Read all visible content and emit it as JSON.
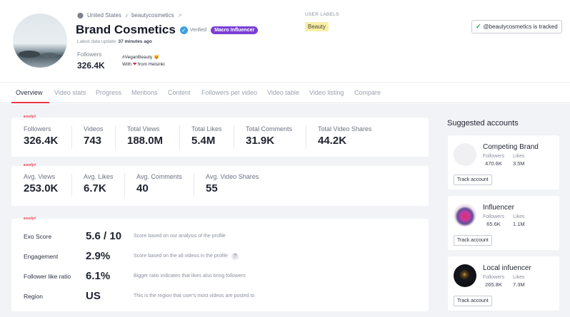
{
  "profile": {
    "location": "United States",
    "handle": "beautycosmetics",
    "name": "Brand Cosmetics",
    "verified_label": "Verified",
    "tier_badge": "Macro Influencer",
    "updated_prefix": "Latest data update:",
    "updated_value": "37 minutes ago",
    "followers_label": "Followers",
    "followers_value": "326.4K",
    "bio_line1": "#VeganBeauty 😺",
    "bio_line2_pre": "With",
    "bio_line2_post": "from Helsinki"
  },
  "labels": {
    "title": "USER LABELS",
    "items": [
      "Beauty"
    ]
  },
  "tracking": {
    "text": "@beautycosmetics is tracked"
  },
  "tabs": [
    {
      "label": "Overview",
      "active": true
    },
    {
      "label": "Video stats"
    },
    {
      "label": "Progress"
    },
    {
      "label": "Mentions"
    },
    {
      "label": "Content"
    },
    {
      "label": "Followers per video"
    },
    {
      "label": "Video table"
    },
    {
      "label": "Video listing"
    },
    {
      "label": "Compare"
    }
  ],
  "watermark": "exolyt",
  "summary": [
    {
      "label": "Followers",
      "value": "326.4K"
    },
    {
      "label": "Videos",
      "value": "743"
    },
    {
      "label": "Total Views",
      "value": "188.0M"
    },
    {
      "label": "Total Likes",
      "value": "5.4M"
    },
    {
      "label": "Total Comments",
      "value": "31.9K"
    },
    {
      "label": "Total Video Shares",
      "value": "44.2K"
    }
  ],
  "averages": [
    {
      "label": "Avg. Views",
      "value": "253.0K"
    },
    {
      "label": "Avg. Likes",
      "value": "6.7K"
    },
    {
      "label": "Avg. Comments",
      "value": "40"
    },
    {
      "label": "Avg. Video Shares",
      "value": "55"
    }
  ],
  "scores": [
    {
      "label": "Exo Score",
      "value": "5.6 / 10",
      "desc": "Score based on our analysis of the profile"
    },
    {
      "label": "Engagement",
      "value": "2.9%",
      "desc": "Score based on the all videos in the profile",
      "help": "?"
    },
    {
      "label": "Follower like ratio",
      "value": "6.1%",
      "desc": "Bigger ratio indicates that likes also bring followers"
    },
    {
      "label": "Region",
      "value": "US",
      "desc": "This is the region that user's most videos are posted to"
    }
  ],
  "suggested": {
    "title": "Suggested accounts",
    "button_label": "Track account",
    "followers_label": "Followers",
    "likes_label": "Likes",
    "accounts": [
      {
        "name": "Competing Brand",
        "followers": "470.6K",
        "likes": "3.5M"
      },
      {
        "name": "Influencer",
        "followers": "65.6K",
        "likes": "1.1M"
      },
      {
        "name": "Local infuencer",
        "followers": "265.8K",
        "likes": "7.3M"
      }
    ]
  }
}
